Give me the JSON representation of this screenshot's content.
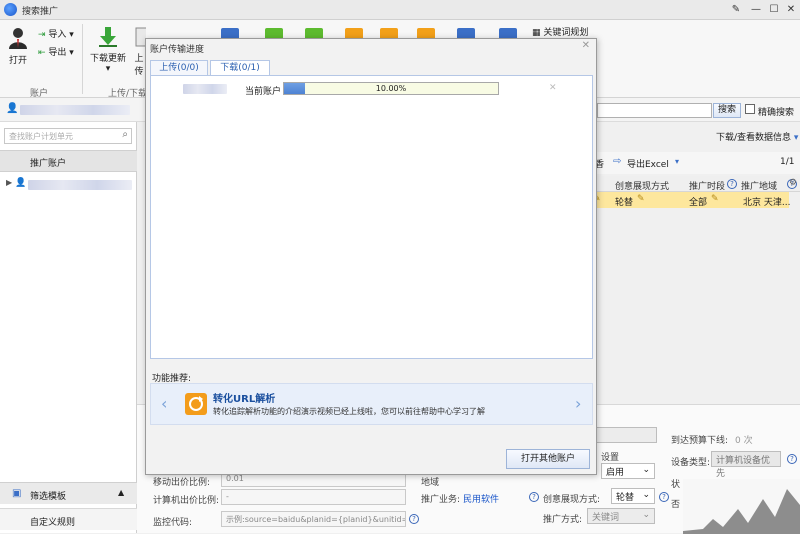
{
  "window": {
    "title": "搜索推广"
  },
  "ribbon": {
    "open": "打开",
    "import": "导入",
    "export": "导出",
    "download_update": "下载更新",
    "upload_partial": "上传",
    "keyword_tool": "关键词规划",
    "group_account": "账户",
    "group_upload_download": "上传/下载"
  },
  "left": {
    "search_placeholder": "查找账户计划单元",
    "section_title": "推广账户",
    "filter_template": "筛选模板",
    "custom_rules": "自定义规则"
  },
  "top_search": {
    "search_button": "搜索",
    "exact_search": "精确搜索",
    "download_view": "下载/查看数据信息"
  },
  "table": {
    "export_excel": "导出Excel",
    "page": "1/1",
    "headers": [
      "创意展现方式",
      "推广时段",
      "推广地域"
    ],
    "row": {
      "display_mode": "轮替",
      "time": "全部",
      "region": "北京 天津..."
    }
  },
  "settings": {
    "daily_budget_label": "到达预算下线:",
    "daily_budget_value": "0 次",
    "device_type_label": "设备类型:",
    "device_type_value": "计算机设备优先",
    "enable_value": "启用",
    "device_settings_label": "设置",
    "mobile_bid_label": "移动出价比例:",
    "mobile_bid_value": "0.01",
    "pc_bid_label": "计算机出价比例:",
    "pc_bid_value": "-",
    "monitor_code_label": "监控代码:",
    "monitor_code_placeholder": "示例:source=baidu&planid={planid}&unitid={ur",
    "business_label": "推广业务:",
    "business_value": "民用软件",
    "display_mode_label": "创意展现方式:",
    "display_mode_value": "轮替",
    "promo_method_label": "推广方式:",
    "promo_method_value": "关键词",
    "status_label": "状",
    "other_label": "否",
    "region_label": "地域"
  },
  "dialog": {
    "title": "账户传输进度",
    "tab_upload": "上传(0/0)",
    "tab_download": "下载(0/1)",
    "current_account": "当前账户",
    "progress": 10.0,
    "progress_text": "10.00%",
    "recommend_label": "功能推荐:",
    "rec_title": "转化URL解析",
    "rec_desc": "转化追踪解析功能的介绍演示视频已经上线啦，您可以前往帮助中心学习了解",
    "open_other": "打开其他账户"
  }
}
